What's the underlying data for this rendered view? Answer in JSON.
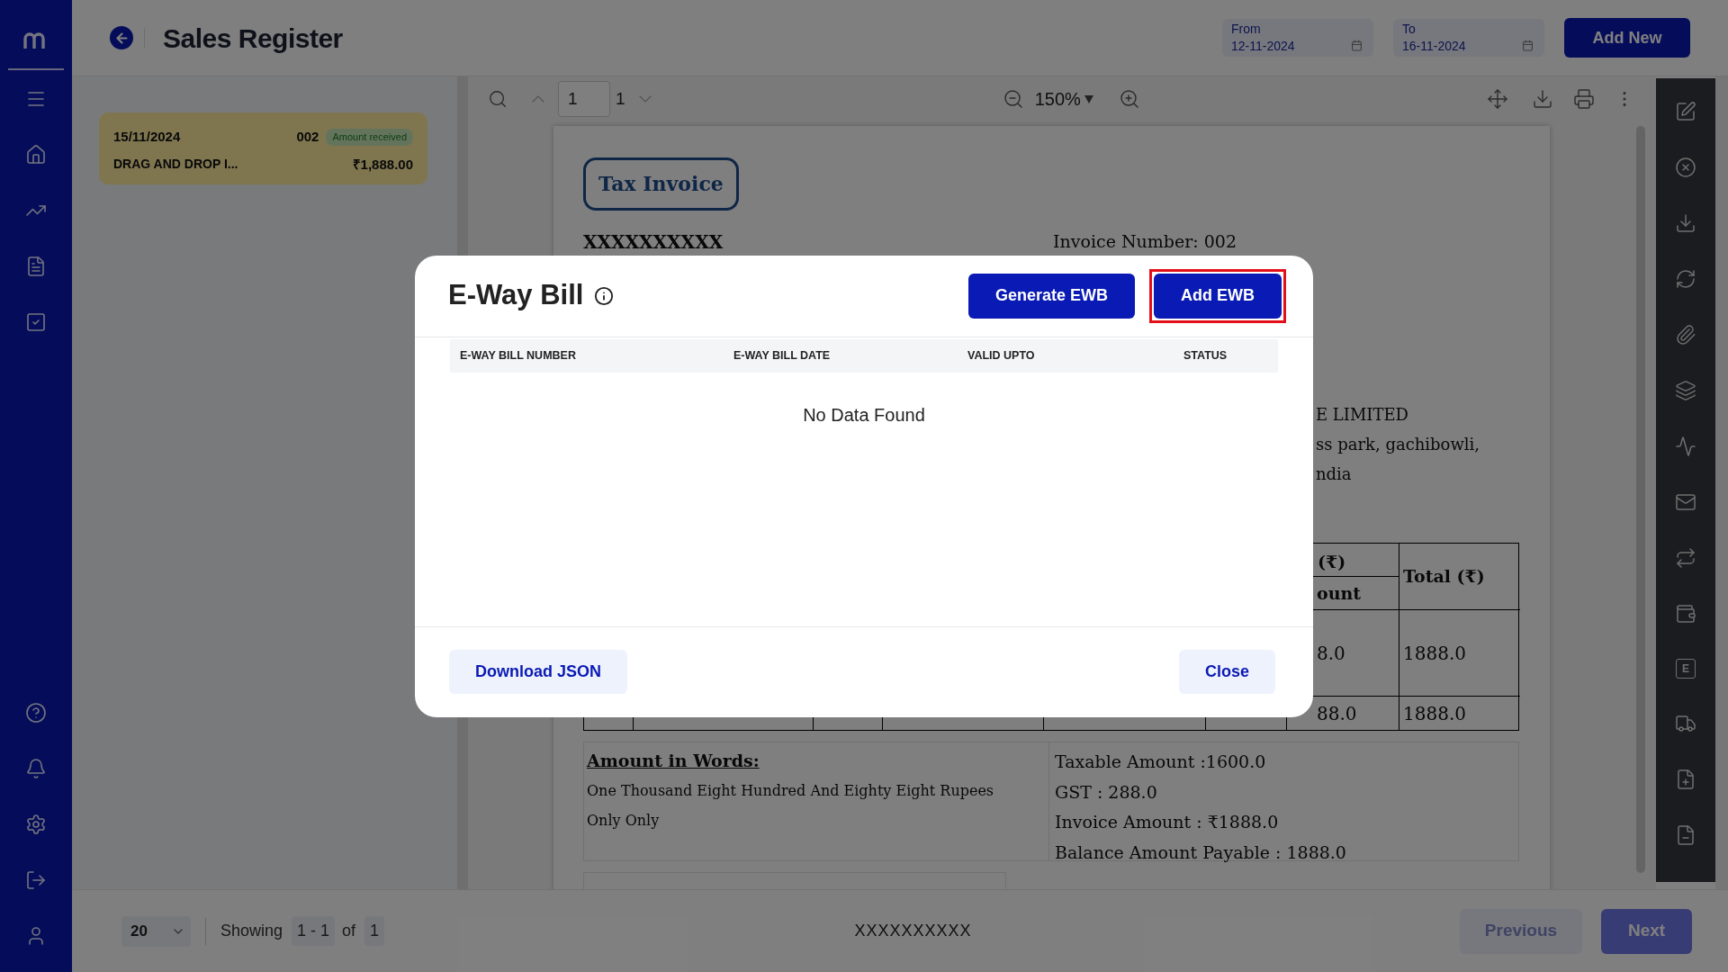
{
  "header": {
    "title": "Sales Register",
    "date_from": {
      "label": "From",
      "value": "12-11-2024"
    },
    "date_to": {
      "label": "To",
      "value": "16-11-2024"
    },
    "add_button": "Add New"
  },
  "list": [
    {
      "date": "15/11/2024",
      "number": "002",
      "status": "Amount received",
      "name": "DRAG AND DROP I...",
      "amount": "₹1,888.00",
      "selected": true
    }
  ],
  "viewer": {
    "page_input": "1",
    "page_count": "1",
    "zoom": "150%"
  },
  "document": {
    "title": "Tax Invoice",
    "company": "XXXXXXXXXX",
    "invoice_number": "Invoice Number: 002",
    "address_lines": [
      "E LIMITED",
      "ss park, gachibowli,",
      "ndia"
    ],
    "table": {
      "header_top": "(₹)",
      "header_sub": "ount",
      "header_total": "Total (₹)",
      "rows": [
        [
          "8.0",
          "1888.0"
        ],
        [
          "88.0",
          "1888.0"
        ]
      ]
    },
    "words_heading": "Amount in Words:",
    "words": "One Thousand Eight Hundred And Eighty Eight Rupees Only Only",
    "summary": [
      "Taxable Amount :1600.0",
      "GST : 288.0",
      "Invoice Amount : ₹1888.0",
      "Balance Amount Payable : 1888.0"
    ]
  },
  "rail": [
    {
      "kind": "edit"
    },
    {
      "kind": "cancel"
    },
    {
      "kind": "download"
    },
    {
      "kind": "refresh"
    },
    {
      "kind": "attach"
    },
    {
      "kind": "layers"
    },
    {
      "kind": "activity"
    },
    {
      "kind": "mail"
    },
    {
      "kind": "repeat"
    },
    {
      "kind": "wallet"
    },
    {
      "kind": "letter",
      "text": "E"
    },
    {
      "kind": "truck"
    },
    {
      "kind": "file-plus"
    },
    {
      "kind": "file-minus"
    }
  ],
  "modal": {
    "title": "E-Way Bill",
    "buttons": [
      {
        "label": "Generate EWB",
        "highlighted": false
      },
      {
        "label": "Add EWB",
        "highlighted": true
      }
    ],
    "columns": [
      "E-WAY BILL NUMBER",
      "E-WAY BILL DATE",
      "VALID UPTO",
      "STATUS"
    ],
    "empty_text": "No Data Found",
    "footer_buttons": [
      "Download JSON",
      "Close"
    ]
  },
  "footer": {
    "page_size": "20",
    "showing_label": "Showing",
    "range": "1 - 1",
    "of_label": "of",
    "total": "1",
    "center_text": "XXXXXXXXXX",
    "previous": {
      "label": "Previous",
      "disabled": true
    },
    "next": {
      "label": "Next",
      "disabled": false
    }
  }
}
